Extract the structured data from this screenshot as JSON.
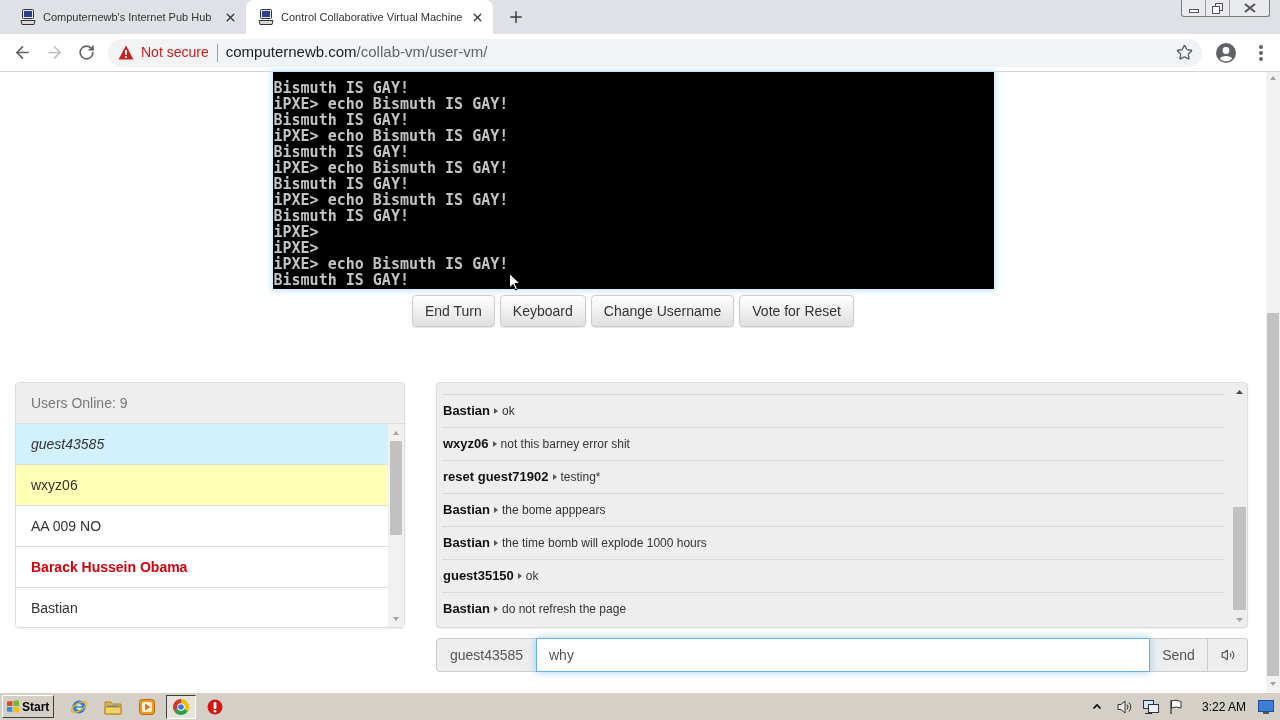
{
  "browser": {
    "tabs": [
      {
        "title": "Computernewb's Internet Pub Hub",
        "selected": false
      },
      {
        "title": "Control Collaborative Virtual Machine",
        "selected": true
      }
    ],
    "security": "Not secure",
    "url_host": "computernewb.com",
    "url_path": "/collab-vm/user-vm/"
  },
  "vm_screen": {
    "lines": [
      "Bismuth IS GAY!",
      "iPXE> echo Bismuth IS GAY!",
      "Bismuth IS GAY!",
      "iPXE> echo Bismuth IS GAY!",
      "Bismuth IS GAY!",
      "iPXE> echo Bismuth IS GAY!",
      "Bismuth IS GAY!",
      "iPXE> echo Bismuth IS GAY!",
      "Bismuth IS GAY!",
      "iPXE>",
      "iPXE>",
      "iPXE> echo Bismuth IS GAY!",
      "Bismuth IS GAY!"
    ]
  },
  "vm_buttons": [
    "End Turn",
    "Keyboard",
    "Change Username",
    "Vote for Reset"
  ],
  "users": {
    "header": "Users Online: 9",
    "items": [
      {
        "name": "guest43585",
        "kind": "self"
      },
      {
        "name": "wxyz06",
        "kind": "turn"
      },
      {
        "name": "AA 009 NO",
        "kind": "normal"
      },
      {
        "name": "Barack Hussein Obama",
        "kind": "admin"
      },
      {
        "name": "Bastian",
        "kind": "normal"
      }
    ]
  },
  "chat": {
    "messages": [
      {
        "user": "Bastian",
        "text": "ok"
      },
      {
        "user": "wxyz06",
        "text": "not this barney error shit"
      },
      {
        "user": "reset guest71902",
        "text": "testing*"
      },
      {
        "user": "Bastian",
        "text": "the bome apppears"
      },
      {
        "user": "Bastian",
        "text": "the time bomb will explode 1000 hours"
      },
      {
        "user": "guest35150",
        "text": "ok"
      },
      {
        "user": "Bastian",
        "text": "do not refresh the page"
      }
    ]
  },
  "chat_input": {
    "username": "guest43585",
    "value": "why",
    "send": "Send"
  },
  "taskbar": {
    "start": "Start",
    "items": [
      {
        "selected": false
      },
      {
        "selected": false
      },
      {
        "selected": false
      },
      {
        "selected": true
      },
      {
        "selected": false
      }
    ],
    "clock": "3:22 AM"
  }
}
